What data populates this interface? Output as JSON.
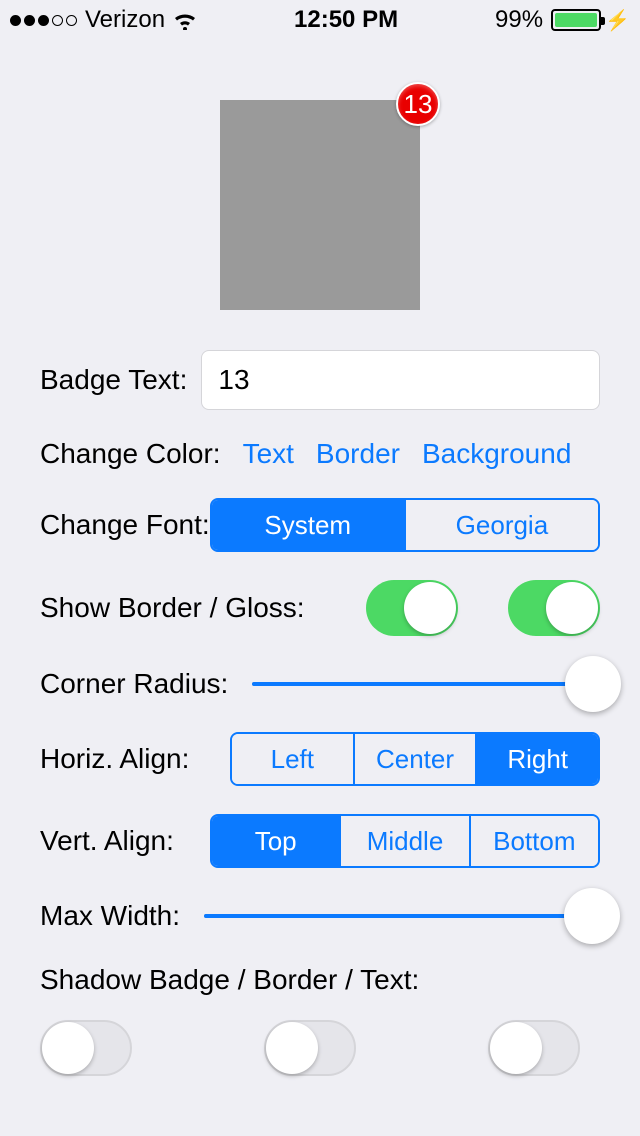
{
  "statusbar": {
    "carrier": "Verizon",
    "time": "12:50 PM",
    "battery_pct": "99%"
  },
  "preview": {
    "badge_text": "13"
  },
  "labels": {
    "badge_text": "Badge Text:",
    "change_color": "Change Color:",
    "change_font": "Change Font:",
    "show_border_gloss": "Show Border / Gloss:",
    "corner_radius": "Corner Radius:",
    "horiz_align": "Horiz. Align:",
    "vert_align": "Vert. Align:",
    "max_width": "Max Width:",
    "shadow": "Shadow Badge / Border / Text:"
  },
  "inputs": {
    "badge_text_value": "13"
  },
  "color_buttons": {
    "text": "Text",
    "border": "Border",
    "background": "Background"
  },
  "font_segments": {
    "system": "System",
    "georgia": "Georgia",
    "selected": "system"
  },
  "toggles": {
    "show_border": true,
    "show_gloss": true
  },
  "sliders": {
    "corner_radius_frac": 0.98,
    "max_width_frac": 0.98
  },
  "halign": {
    "left": "Left",
    "center": "Center",
    "right": "Right",
    "selected": "right"
  },
  "valign": {
    "top": "Top",
    "middle": "Middle",
    "bottom": "Bottom",
    "selected": "top"
  },
  "shadow_toggles": {
    "badge": false,
    "border": false,
    "text": false
  }
}
